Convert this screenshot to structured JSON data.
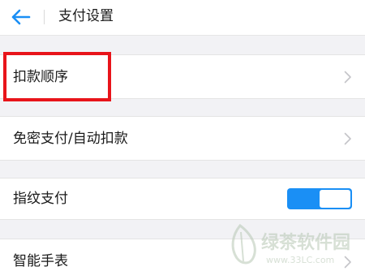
{
  "header": {
    "title": "支付设置",
    "back_icon": "arrow-left-icon"
  },
  "rows": {
    "debit_order": {
      "label": "扣款顺序"
    },
    "password_free": {
      "label": "免密支付/自动扣款"
    },
    "fingerprint": {
      "label": "指纹支付",
      "toggle_on": true
    },
    "smart_watch": {
      "label": "智能手表"
    }
  },
  "watermark": {
    "text": "绿茶软件园",
    "url": "www.33LC.com"
  },
  "colors": {
    "accent": "#1a8ff5",
    "highlight": "#e8141a",
    "background": "#f2f2f5",
    "watermark": "#b7c7b4"
  }
}
